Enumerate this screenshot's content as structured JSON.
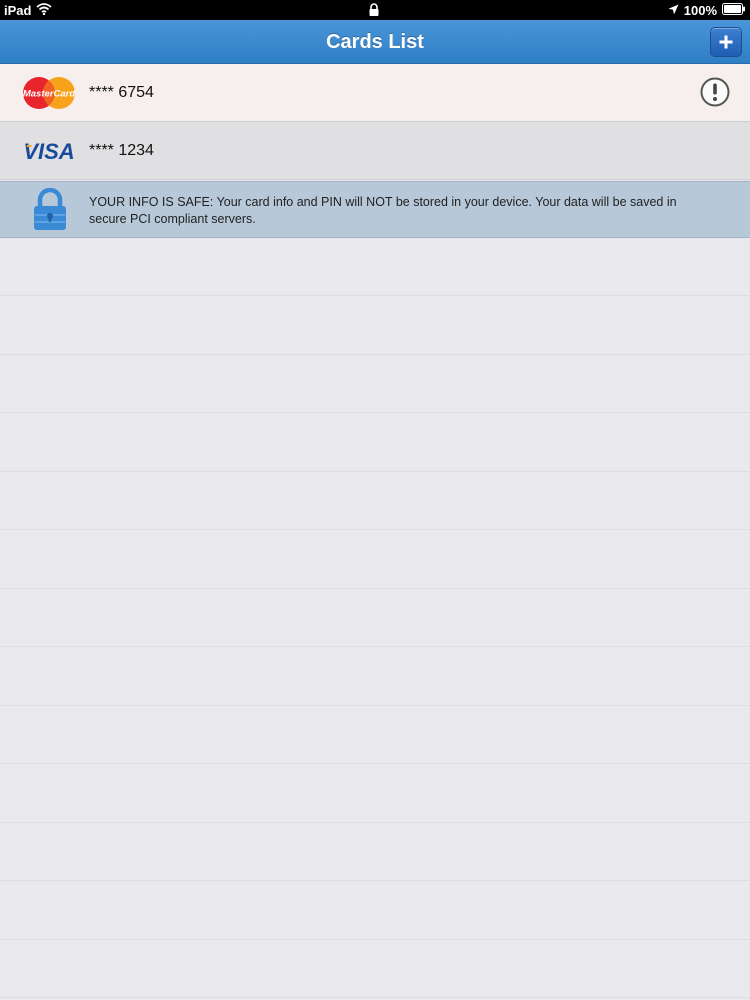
{
  "status_bar": {
    "device": "iPad",
    "battery": "100%"
  },
  "nav": {
    "title": "Cards List",
    "add_button_label": "+"
  },
  "cards": [
    {
      "brand": "MasterCard",
      "number": "**** 6754",
      "has_alert": true
    },
    {
      "brand": "VISA",
      "number": "**** 1234",
      "has_alert": false
    }
  ],
  "info": {
    "text": "YOUR INFO IS SAFE: Your card info and PIN will NOT be stored in your device. Your data will be saved in secure PCI compliant servers."
  },
  "colors": {
    "nav_blue": "#3a88cf",
    "mastercard_red": "#e8242c",
    "mastercard_orange": "#f7a21b",
    "visa_blue": "#1a4a9c",
    "visa_gold": "#f5a91d",
    "lock_blue": "#3a8ad6"
  },
  "icons": {
    "wifi": "wifi-icon",
    "lock": "lock-icon",
    "location": "location-arrow-icon",
    "battery": "battery-icon",
    "add": "plus-icon",
    "alert": "exclamation-circle-icon",
    "secure": "padlock-icon"
  }
}
